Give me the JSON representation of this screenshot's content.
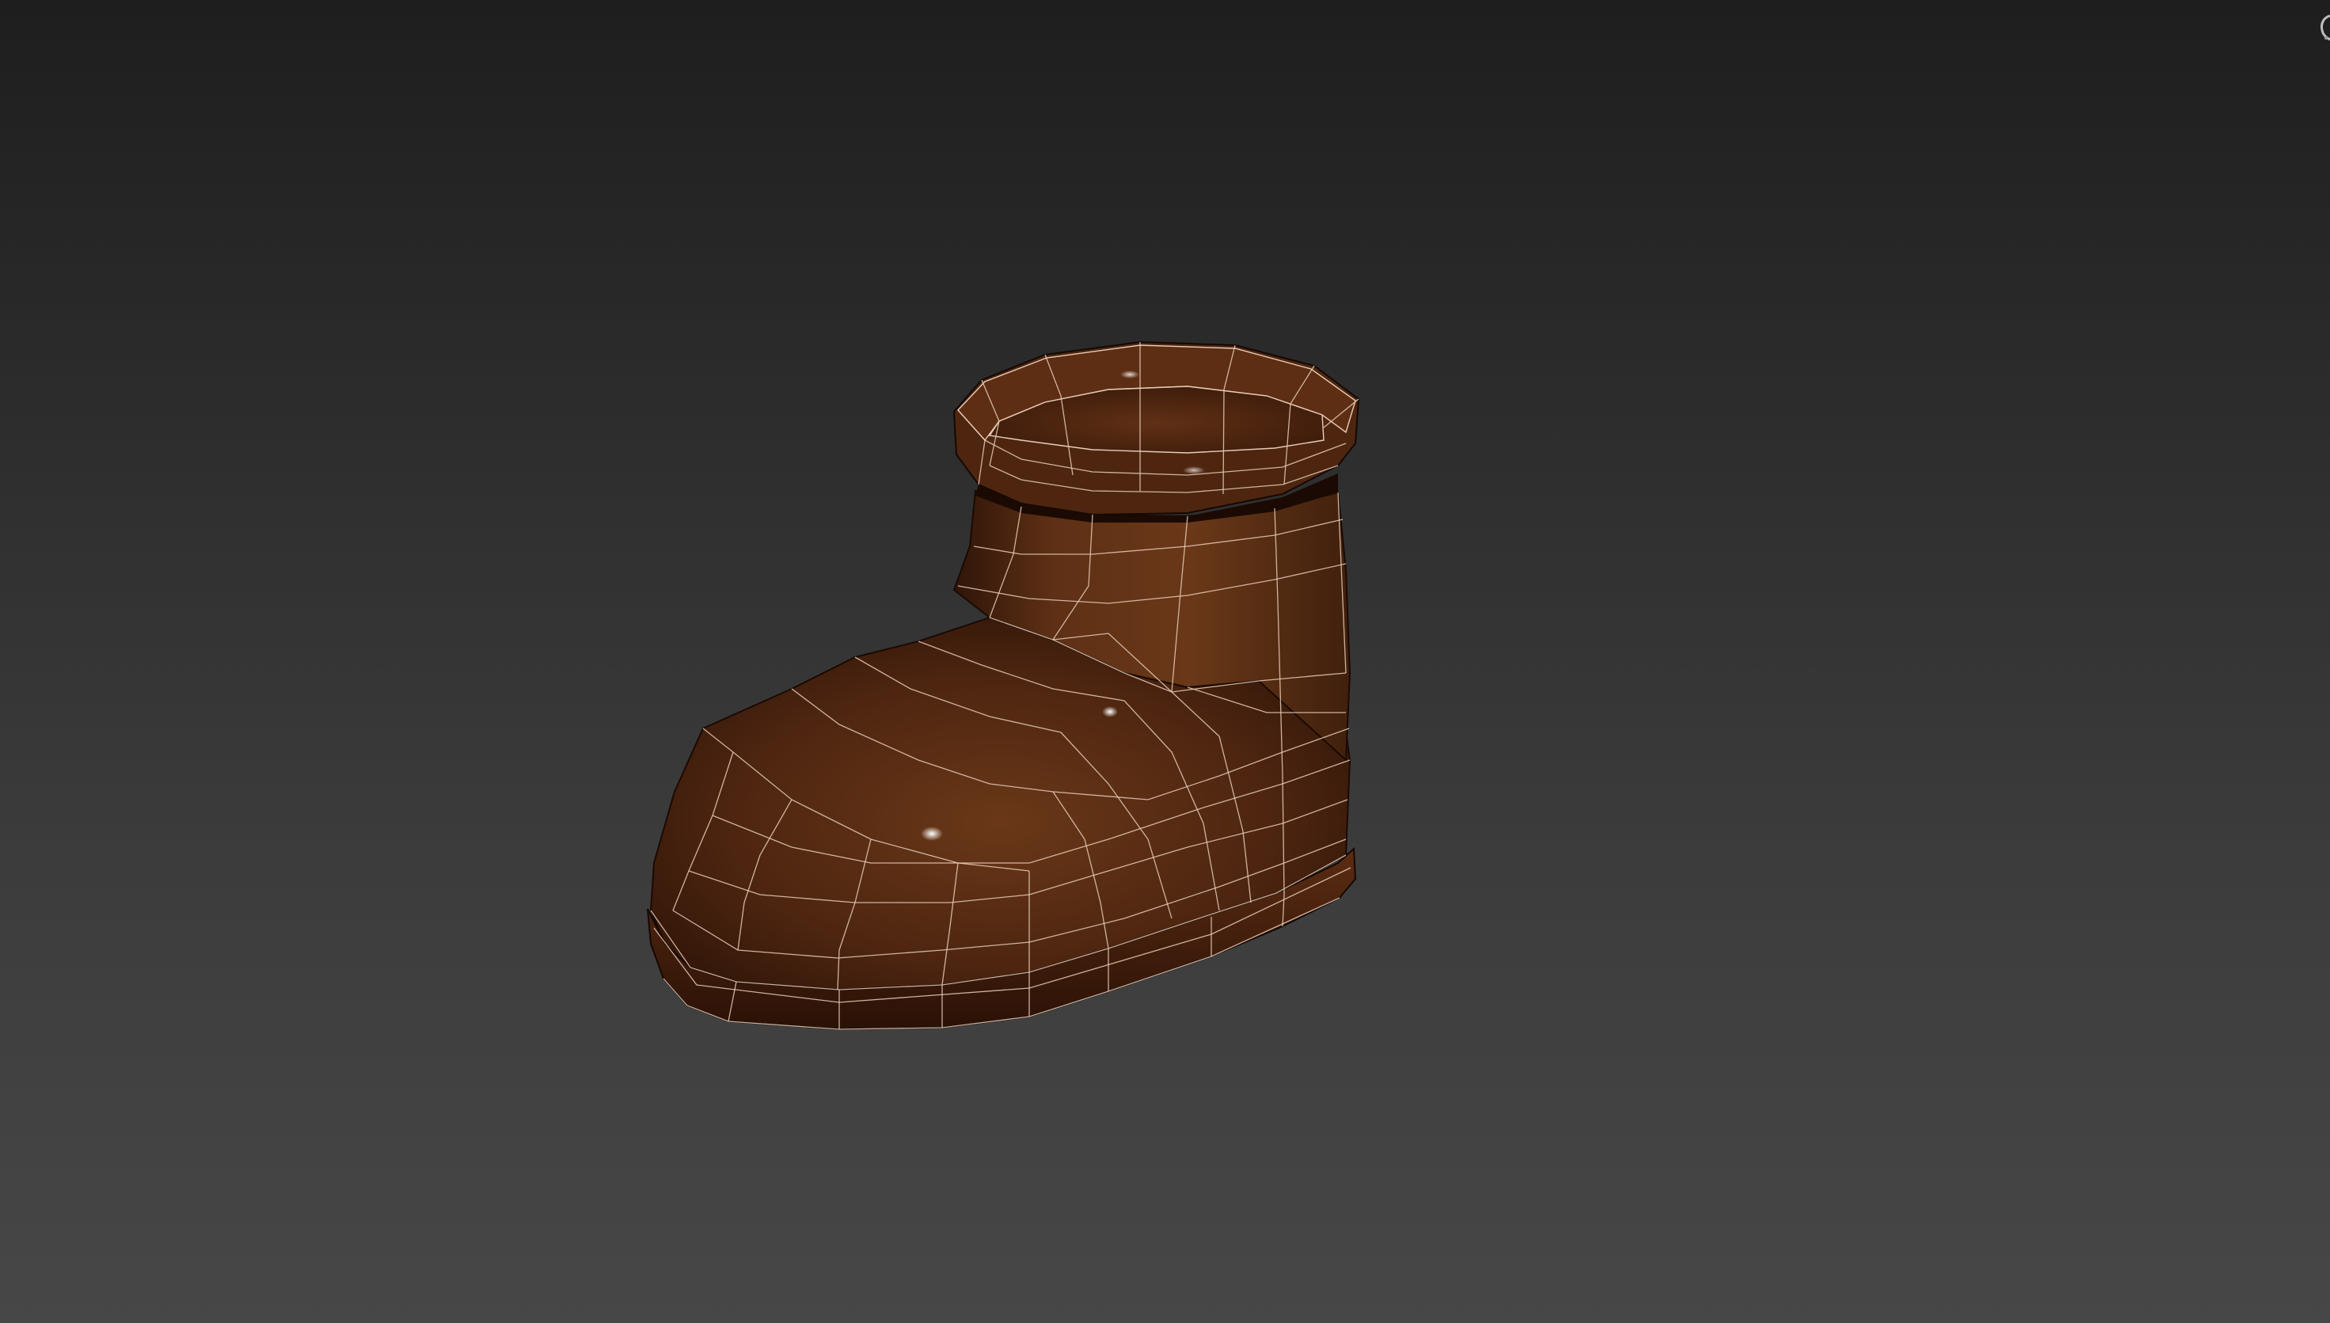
{
  "viewport": {
    "background_top": "#1e1e1e",
    "background_bottom": "#474747",
    "shading_mode": "smooth-shaded-with-edged-faces"
  },
  "model": {
    "name": "",
    "type": "low-poly-boot-mesh",
    "material_color": "#5a2e14",
    "material_shadow": "#2a1207",
    "wire_color": "#e8cdb8"
  },
  "overlay": {
    "corner_icon": "viewcube-icon"
  }
}
